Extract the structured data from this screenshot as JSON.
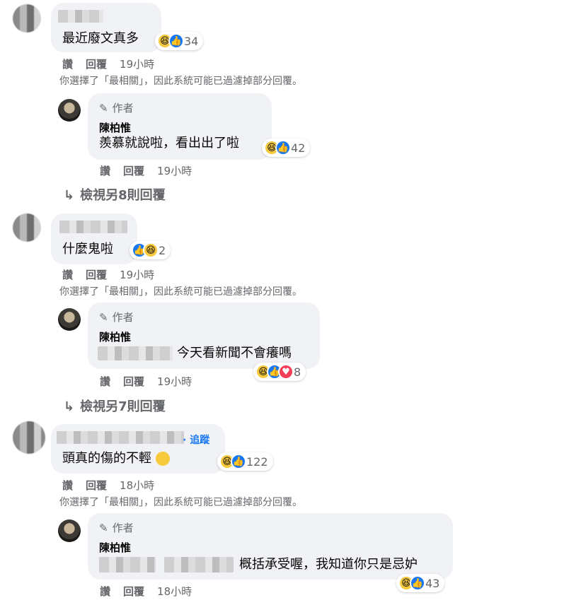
{
  "threads": [
    {
      "comment": {
        "text": "最近廢文真多",
        "reaction_count": "34",
        "actions": {
          "like": "讚",
          "reply": "回覆",
          "time": "19小時"
        }
      },
      "filter_note": "你選擇了「最相關」，因此系統可能已過濾掉部分回覆。",
      "reply": {
        "author_tag": "作者",
        "author_name": "陳柏惟",
        "text": "羨慕就說啦，看出出了啦",
        "reaction_count": "42",
        "actions": {
          "like": "讚",
          "reply": "回覆",
          "time": "19小時"
        }
      },
      "view_more": "檢視另8則回覆"
    },
    {
      "comment": {
        "text": "什麼鬼啦",
        "reaction_count": "2",
        "actions": {
          "like": "讚",
          "reply": "回覆",
          "time": "19小時"
        }
      },
      "filter_note": "你選擇了「最相關」，因此系統可能已過濾掉部分回覆。",
      "reply": {
        "author_tag": "作者",
        "author_name": "陳柏惟",
        "text": "今天看新聞不會癢嗎",
        "reaction_count": "8",
        "actions": {
          "like": "讚",
          "reply": "回覆",
          "time": "19小時"
        }
      },
      "view_more": "檢視另7則回覆"
    },
    {
      "comment": {
        "follow_label": "· 追蹤",
        "text": "頭真的傷的不輕",
        "reaction_count": "122",
        "actions": {
          "like": "讚",
          "reply": "回覆",
          "time": "18小時"
        }
      },
      "filter_note": "你選擇了「最相關」，因此系統可能已過濾掉部分回覆。",
      "reply": {
        "author_tag": "作者",
        "author_name": "陳柏惟",
        "text": "概括承受喔，我知道你只是忌妒",
        "reaction_count": "43",
        "actions": {
          "like": "讚",
          "reply": "回覆",
          "time": "18小時"
        }
      }
    }
  ],
  "icons": {
    "view_more_arrow": "reply-arrow-icon",
    "author_tag": "pencil-icon",
    "reactions": [
      "haha-icon",
      "like-icon",
      "love-icon"
    ]
  },
  "colors": {
    "bubble": "#f0f2f5",
    "secondary_text": "#65676b",
    "link": "#1877f2",
    "like": "#1877f2",
    "haha": "#f7c93d",
    "love": "#f33e58"
  }
}
